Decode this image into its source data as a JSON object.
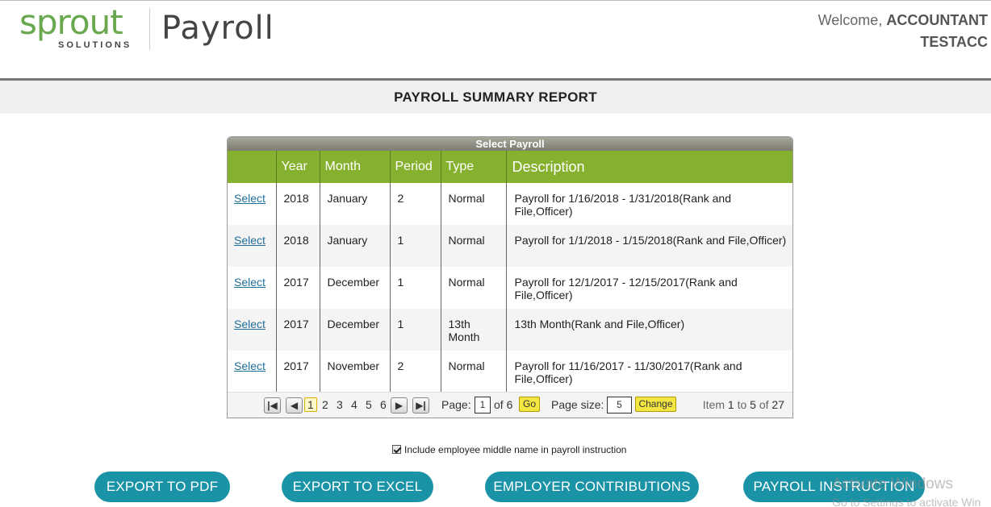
{
  "header": {
    "logo_word": "sprout",
    "logo_sub": "SOLUTIONS",
    "app_title": "Payroll",
    "welcome_prefix": "Welcome,",
    "user_name": "ACCOUNTANT",
    "company": "TESTACC"
  },
  "page_title": "PAYROLL SUMMARY REPORT",
  "grid": {
    "caption": "Select Payroll",
    "columns": [
      "",
      "Year",
      "Month",
      "Period",
      "Type",
      "Description"
    ],
    "rows": [
      {
        "action": "Select",
        "year": "2018",
        "month": "January",
        "period": "2",
        "type": "Normal",
        "description": "Payroll for 1/16/2018 - 1/31/2018(Rank and File,Officer)"
      },
      {
        "action": "Select",
        "year": "2018",
        "month": "January",
        "period": "1",
        "type": "Normal",
        "description": "Payroll for 1/1/2018 - 1/15/2018(Rank and File,Officer)"
      },
      {
        "action": "Select",
        "year": "2017",
        "month": "December",
        "period": "1",
        "type": "Normal",
        "description": "Payroll for 12/1/2017 - 12/15/2017(Rank and File,Officer)"
      },
      {
        "action": "Select",
        "year": "2017",
        "month": "December",
        "period": "1",
        "type": "13th Month",
        "description": "13th Month(Rank and File,Officer)"
      },
      {
        "action": "Select",
        "year": "2017",
        "month": "November",
        "period": "2",
        "type": "Normal",
        "description": "Payroll for 11/16/2017 - 11/30/2017(Rank and File,Officer)"
      }
    ],
    "pager": {
      "first_icon": "first-page-icon",
      "prev_icon": "prev-page-icon",
      "next_icon": "next-page-icon",
      "last_icon": "last-page-icon",
      "pages": [
        "1",
        "2",
        "3",
        "4",
        "5",
        "6"
      ],
      "current_page": "1",
      "page_label": "Page:",
      "page_value": "1",
      "of_label": "of 6",
      "go_label": "Go",
      "size_label": "Page size:",
      "size_value": "5",
      "change_label": "Change",
      "item_prefix": "Item",
      "item_from": "1",
      "item_to_word": "to",
      "item_to": "5",
      "item_of_word": "of",
      "item_total": "27"
    }
  },
  "checkbox": {
    "label": "Include employee middle name in payroll instruction",
    "checked": true
  },
  "actions": {
    "export_pdf": "EXPORT TO PDF",
    "export_excel": "EXPORT TO EXCEL",
    "employer_contributions": "EMPLOYER CONTRIBUTIONS",
    "payroll_instruction": "PAYROLL INSTRUCTION"
  },
  "watermark": {
    "line1": "Activate Windows",
    "line2": "Go to Settings to activate Win"
  },
  "colors": {
    "grid_header": "#86b12f",
    "button": "#1b93a6",
    "logo_green": "#6aa84f"
  }
}
